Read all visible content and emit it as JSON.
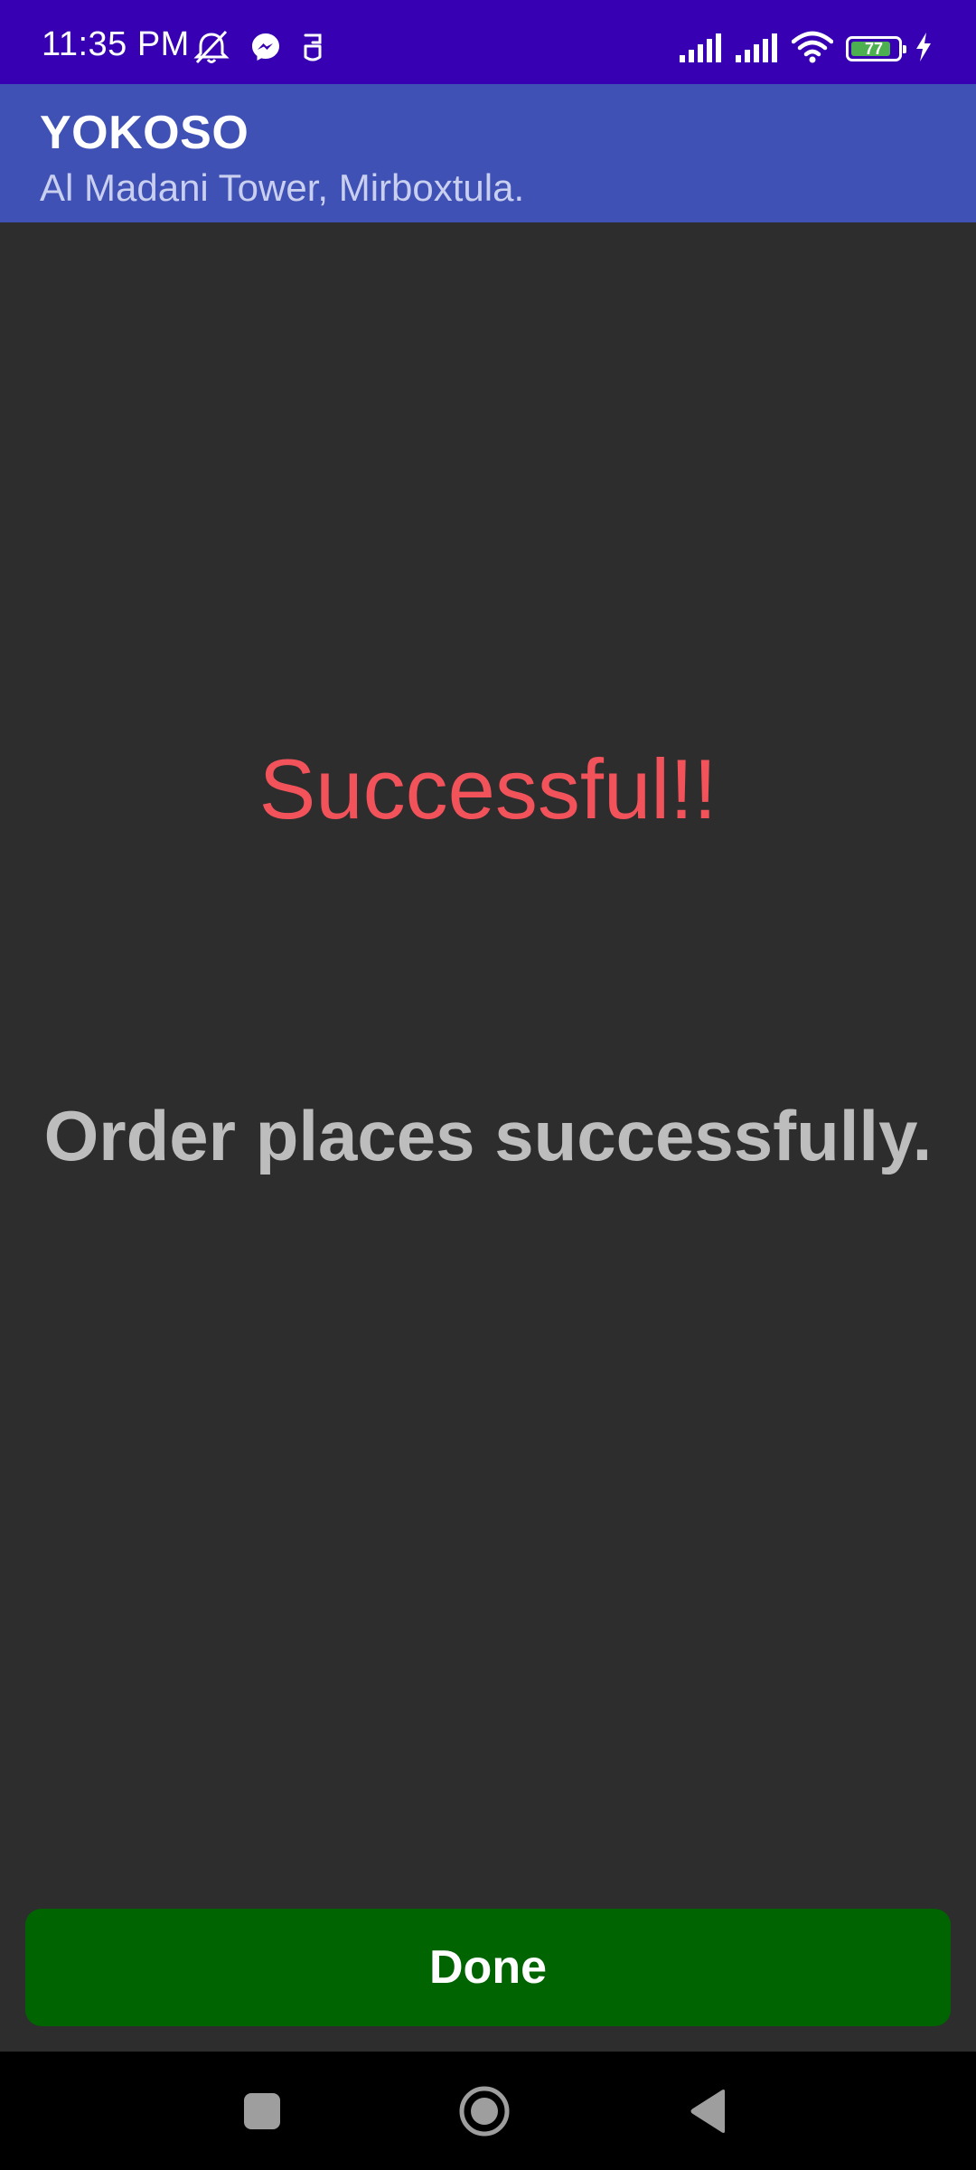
{
  "status_bar": {
    "time": "11:35 PM",
    "left_icons": [
      "alarm-off-icon",
      "messenger-icon",
      "notification-app-icon"
    ],
    "right_icons": [
      "cellular-signal-icon",
      "cellular-signal-icon",
      "wifi-icon",
      "battery-icon",
      "charging-icon"
    ],
    "battery_level": "77"
  },
  "app_bar": {
    "title": "YOKOSO",
    "subtitle": "Al Madani Tower, Mirboxtula."
  },
  "content": {
    "success_title": "Successful!!",
    "success_message": "Order places successfully."
  },
  "actions": {
    "done_label": "Done"
  },
  "nav_bar": {
    "buttons": [
      "recents-icon",
      "home-icon",
      "back-icon"
    ]
  },
  "colors": {
    "status_bar": "#3700b3",
    "app_bar": "#3f51b5",
    "background": "#2d2d2d",
    "success_title": "#f2525a",
    "message_text": "#bdbdbd",
    "done_button": "#006400",
    "battery_fill": "#4caf50"
  }
}
